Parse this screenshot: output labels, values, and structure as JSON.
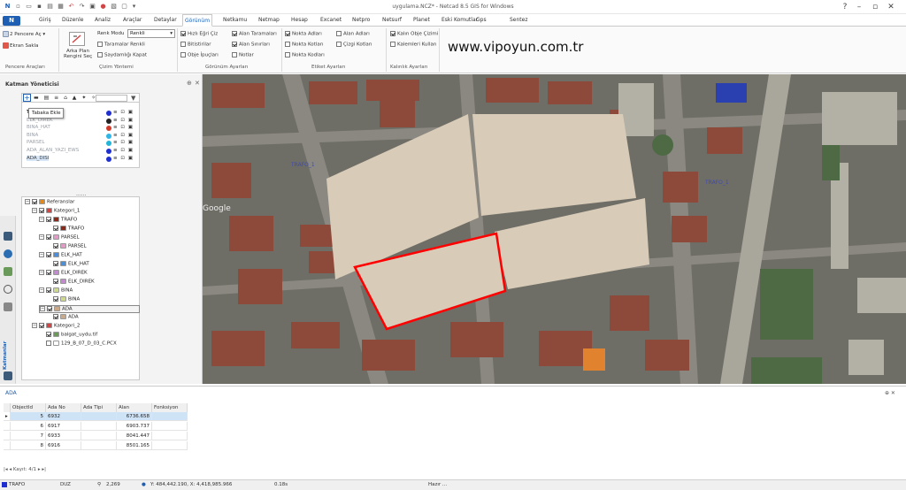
{
  "window": {
    "title": "uygulama.NCZ* - Netcad 8.5 GIS for Windows",
    "file_button": "N"
  },
  "tabs": [
    "Giriş",
    "Düzenle",
    "Analiz",
    "Araçlar",
    "Detaylar",
    "Görünüm",
    "Netkamu",
    "Netmap",
    "Hesap",
    "Excanet",
    "Netpro",
    "Netsurf",
    "Planet",
    "Eski Komutlar",
    "Gps",
    "Sentez"
  ],
  "active_tab": "Görünüm",
  "ribbon": {
    "pencere_ac": "2 Pencere Aç",
    "ekran_sakla": "Ekran Sakla",
    "group_pencere": "Pencere Araçları",
    "arka_plan_1": "Arka Plan",
    "arka_plan_2": "Rengini Seç",
    "renk_modu_label": "Renk Modu",
    "renk_modu_value": "Renkli",
    "taramalar_renkli": "Taramalar Renkli",
    "saydamligi_kapat": "Saydamlığı Kapat",
    "group_cizim": "Çizim Yöntemi",
    "hizli_egri": "Hızlı Eğri Çiz",
    "bitistirilar": "Bitistirilar",
    "obje_ipuclari": "Obje İpuçları",
    "alan_taramalari": "Alan Taramaları",
    "alan_sinirlari": "Alan Sınırları",
    "notlar": "Notlar",
    "group_gorunum": "Görünüm Ayarları",
    "nokta_adlari": "Nokta Adları",
    "nokta_kotlari": "Nokta Kotları",
    "nokta_kodlari": "Nokta Kodları",
    "alan_adlari": "Alan Adları",
    "cizgi_kotlari": "Çizgi Kotları",
    "group_etiket": "Etiket Ayarları",
    "kalin_obje": "Kalın Obje Çizimi",
    "kalemleri_kullan": "Kalemleri Kullan",
    "group_kalinlik": "Kalınlık Ayarları",
    "website": "www.vipoyun.com.tr"
  },
  "left_panel": {
    "title": "Katman Yöneticisi",
    "tooltip": "Tabaka Ekle",
    "layers": [
      "TRAFO",
      "ELK_DIREK",
      "BINA_HAT",
      "BINA",
      "PARSEL",
      "ADA_ALAN_YAZI_EWS",
      "ADA_DISI"
    ],
    "layer_colors": [
      "#1f2fd0",
      "#222222",
      "#d03a2a",
      "#2fb6e8",
      "#22b5d8",
      "#1f2fd0",
      "#1f2fd0"
    ],
    "grip": "......"
  },
  "tree": [
    {
      "label": "Referanslar",
      "indent": 0
    },
    {
      "label": "Kategori_1",
      "indent": 1
    },
    {
      "label": "TRAFO",
      "indent": 2
    },
    {
      "label": "TRAFO",
      "indent": 3
    },
    {
      "label": "PARSEL",
      "indent": 2
    },
    {
      "label": "PARSEL",
      "indent": 3
    },
    {
      "label": "ELK_HAT",
      "indent": 2
    },
    {
      "label": "ELK_HAT",
      "indent": 3
    },
    {
      "label": "ELK_DIREK",
      "indent": 2
    },
    {
      "label": "ELK_DIREK",
      "indent": 3
    },
    {
      "label": "BINA",
      "indent": 2
    },
    {
      "label": "BINA",
      "indent": 3
    },
    {
      "label": "ADA",
      "indent": 2
    },
    {
      "label": "ADA",
      "indent": 3
    },
    {
      "label": "Kategori_2",
      "indent": 1
    },
    {
      "label": "balgat_uydu.tif",
      "indent": 2
    },
    {
      "label": "129_B_07_D_03_C.PCX",
      "indent": 2
    }
  ],
  "side_label": "Katmanlar",
  "map": {
    "google_text": "Google",
    "labels": [
      "TRAFO_1",
      "TRAFO_1"
    ]
  },
  "table": {
    "title": "ADA",
    "pin": "⊕ ✕",
    "columns": [
      "ObjectId",
      "Ada No",
      "Ada Tipi",
      "Alan",
      "Fonksiyon"
    ],
    "rows": [
      {
        "id": "5",
        "ada_no": "6932",
        "tip": "",
        "alan": "6736.658",
        "fonk": ""
      },
      {
        "id": "6",
        "ada_no": "6917",
        "tip": "",
        "alan": "6903.737",
        "fonk": ""
      },
      {
        "id": "7",
        "ada_no": "6933",
        "tip": "",
        "alan": "8041.447",
        "fonk": ""
      },
      {
        "id": "8",
        "ada_no": "6916",
        "tip": "",
        "alan": "8501.165",
        "fonk": ""
      }
    ],
    "record_label": "Kayıt: 4/1"
  },
  "status": {
    "layer": "TRAFO",
    "mode": "DUZ",
    "zoom": "2,269",
    "coords": "Y: 484,442.190, X: 4,418,985.966",
    "time": "0.18s",
    "ready": "Hazır ..."
  }
}
